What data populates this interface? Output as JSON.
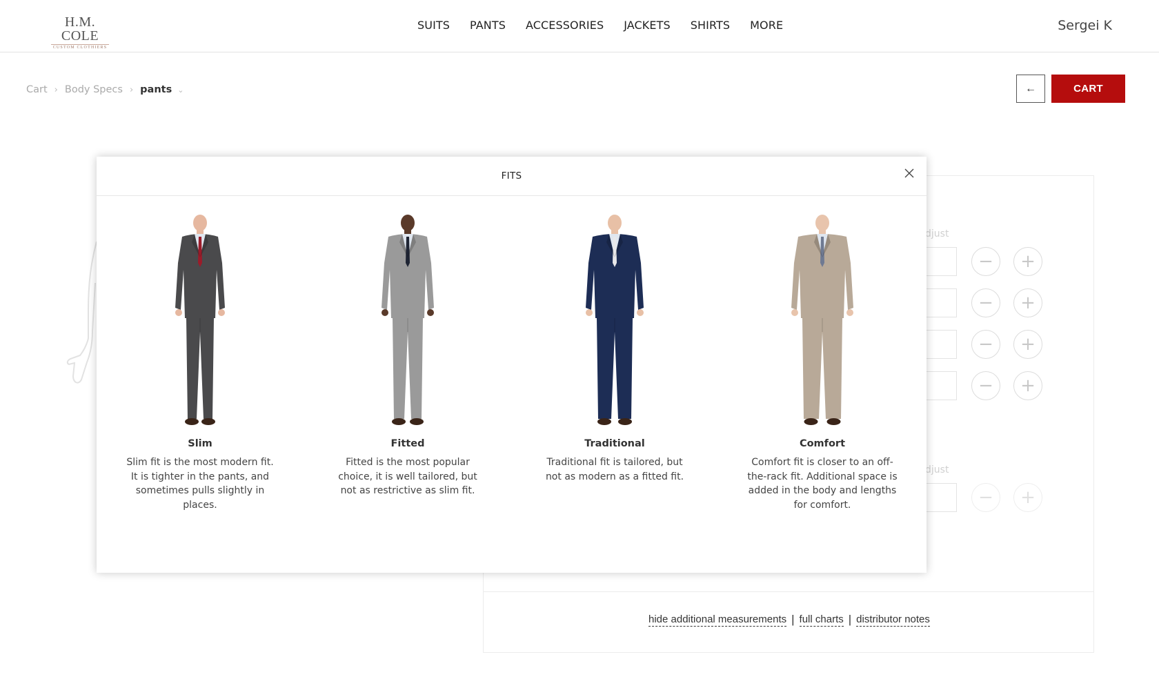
{
  "brand": {
    "name": "H.M. COLE",
    "tagline": "CUSTOM CLOTHIERS"
  },
  "nav": [
    {
      "label": "SUITS"
    },
    {
      "label": "PANTS"
    },
    {
      "label": "ACCESSORIES"
    },
    {
      "label": "JACKETS"
    },
    {
      "label": "SHIRTS"
    },
    {
      "label": "MORE"
    }
  ],
  "user": {
    "name": "Sergei K"
  },
  "breadcrumb": {
    "cart": "Cart",
    "body_specs": "Body Specs",
    "current": "pants"
  },
  "actions": {
    "back_icon": "←",
    "cart_label": "CART"
  },
  "background_panel": {
    "adjust_label_1": "djust",
    "adjust_label_2": "djust",
    "minus": "−",
    "plus": "+"
  },
  "footer_links": {
    "hide": "hide additional measurements",
    "charts": "full charts",
    "notes": "distributor notes",
    "separator": "|"
  },
  "modal": {
    "title": "FITS",
    "fits": [
      {
        "name": "Slim",
        "description": "Slim fit is the most modern fit. It is tighter in the pants, and sometimes pulls slightly in places.",
        "suit_color": "#4a4a4c",
        "tie_color": "#9b1c2a"
      },
      {
        "name": "Fitted",
        "description": "Fitted is the most popular choice, it is well tailored, but not as restrictive as slim fit.",
        "suit_color": "#9a9a9a",
        "tie_color": "#1e2433"
      },
      {
        "name": "Traditional",
        "description": "Traditional fit is tailored, but not as modern as a fitted fit.",
        "suit_color": "#1d2d55",
        "tie_color": "#e8e8ea"
      },
      {
        "name": "Comfort",
        "description": "Comfort fit is closer to an off-the-rack fit. Additional space is added in the body and lengths for comfort.",
        "suit_color": "#b8a998",
        "tie_color": "#6f7a92"
      }
    ]
  },
  "colors": {
    "accent": "#b50d0d"
  }
}
